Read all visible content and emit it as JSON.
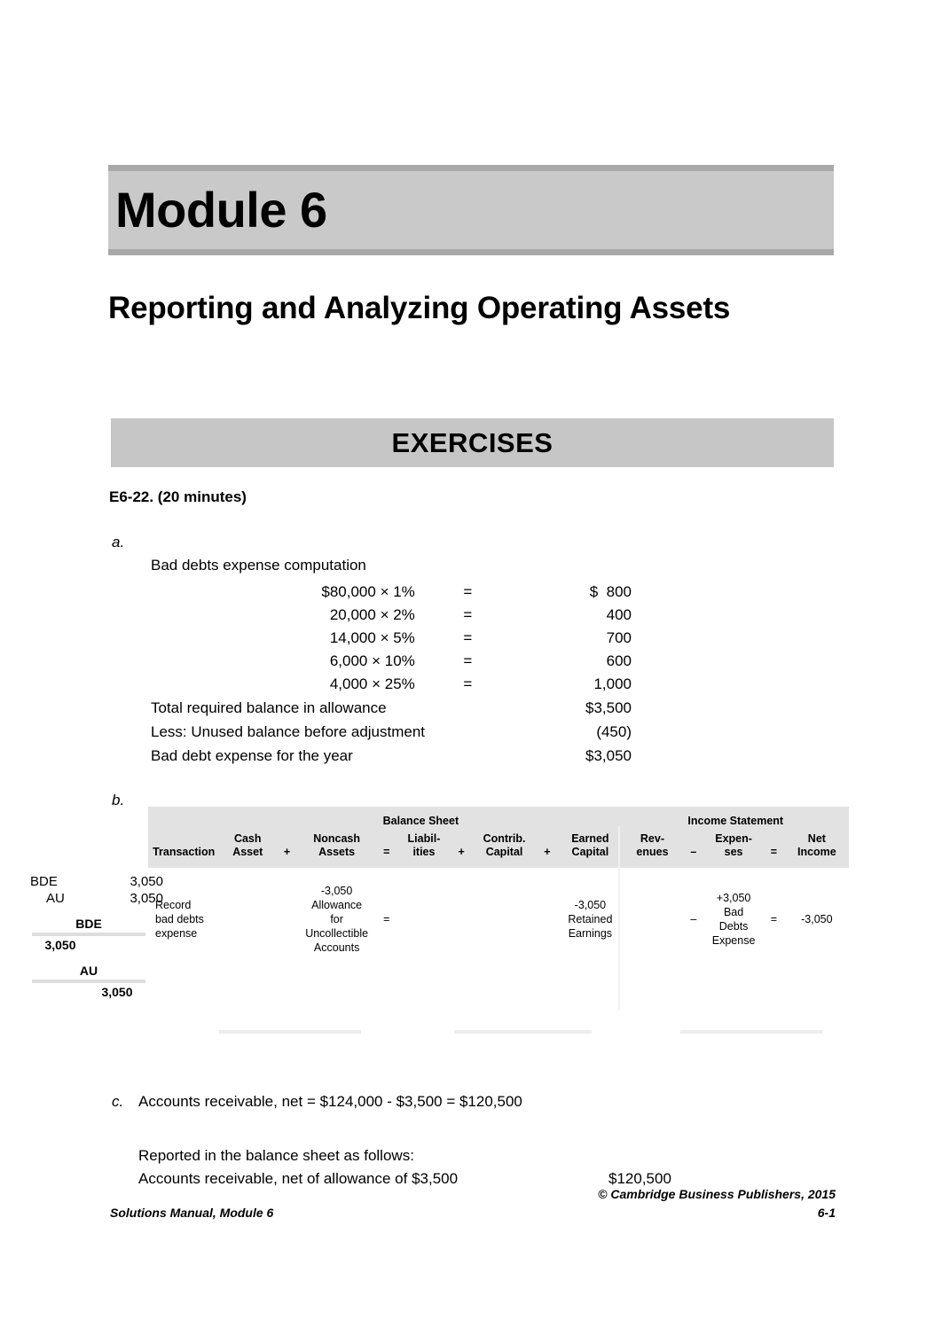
{
  "module": {
    "banner_title": "Module 6",
    "chapter_title": "Reporting and Analyzing Operating Assets",
    "section_banner": "EXERCISES"
  },
  "exercise": {
    "heading": "E6-22. (20 minutes)",
    "part_a_label": "a.",
    "part_b_label": "b.",
    "part_c_label": "c."
  },
  "computation": {
    "caption": "Bad debts expense computation",
    "rows": [
      {
        "expression": "$80,000 × 1%",
        "equals": "=",
        "amount": "800",
        "currency": "$"
      },
      {
        "expression": "20,000 × 2%",
        "equals": "=",
        "amount": "400",
        "currency": ""
      },
      {
        "expression": "14,000 × 5%",
        "equals": "=",
        "amount": "700",
        "currency": ""
      },
      {
        "expression": "6,000 × 10%",
        "equals": "=",
        "amount": "600",
        "currency": ""
      },
      {
        "expression": "4,000 × 25%",
        "equals": "=",
        "amount": "1,000",
        "currency": ""
      }
    ],
    "summary": [
      {
        "label": "Total required balance in allowance",
        "amount": "$3,500"
      },
      {
        "label": "Less: Unused balance before adjustment",
        "amount": "(450)"
      },
      {
        "label": "Bad debt expense for the year",
        "amount": "$3,050"
      }
    ]
  },
  "margin_notes": {
    "journal_entry": {
      "debit_account": "BDE",
      "debit_amount": "3,050",
      "credit_account": "AU",
      "credit_amount": "3,050"
    },
    "t_accounts": [
      {
        "name": "BDE",
        "debit": "3,050",
        "credit": ""
      },
      {
        "name": "AU",
        "debit": "",
        "credit": "3,050"
      }
    ]
  },
  "fse_table": {
    "group_headers": {
      "balance_sheet": "Balance Sheet",
      "income_statement": "Income Statement"
    },
    "columns": [
      {
        "label": "Transaction",
        "type": "header"
      },
      {
        "label": "Cash\nAsset",
        "type": "header"
      },
      {
        "label": "+",
        "type": "operator"
      },
      {
        "label": "Noncash\nAssets",
        "type": "header"
      },
      {
        "label": "=",
        "type": "operator"
      },
      {
        "label": "Liabil-\nities",
        "type": "header"
      },
      {
        "label": "+",
        "type": "operator"
      },
      {
        "label": "Contrib.\nCapital",
        "type": "header"
      },
      {
        "label": "+",
        "type": "operator"
      },
      {
        "label": "Earned\nCapital",
        "type": "header"
      },
      {
        "label": "Rev-\nenues",
        "type": "header"
      },
      {
        "label": "–",
        "type": "operator"
      },
      {
        "label": "Expen-\nses",
        "type": "header"
      },
      {
        "label": "=",
        "type": "operator"
      },
      {
        "label": "Net\nIncome",
        "type": "header"
      }
    ],
    "row": {
      "transaction": "Record\nbad debts\nexpense",
      "cash_asset": "",
      "op1": "",
      "noncash_assets": "-3,050\nAllowance\nfor\nUncollectible\nAccounts",
      "op2": "=",
      "liabilities": "",
      "op3": "",
      "contrib_capital": "",
      "op4": "",
      "earned_capital": "-3,050\nRetained\nEarnings",
      "revenues": "",
      "op5": "–",
      "expenses": "+3,050\nBad\nDebts\nExpense",
      "op6": "=",
      "net_income": "-3,050"
    }
  },
  "part_c": {
    "main_line": "Accounts receivable, net  =  $124,000 - $3,500  = $120,500",
    "sub_heading": "Reported in the balance sheet as follows:",
    "sub_description": "Accounts receivable, net of allowance of $3,500",
    "sub_value": "$120,500"
  },
  "footer": {
    "copyright": "© Cambridge Business Publishers, 2015",
    "left": "Solutions Manual, Module 6",
    "right": "6-1"
  }
}
